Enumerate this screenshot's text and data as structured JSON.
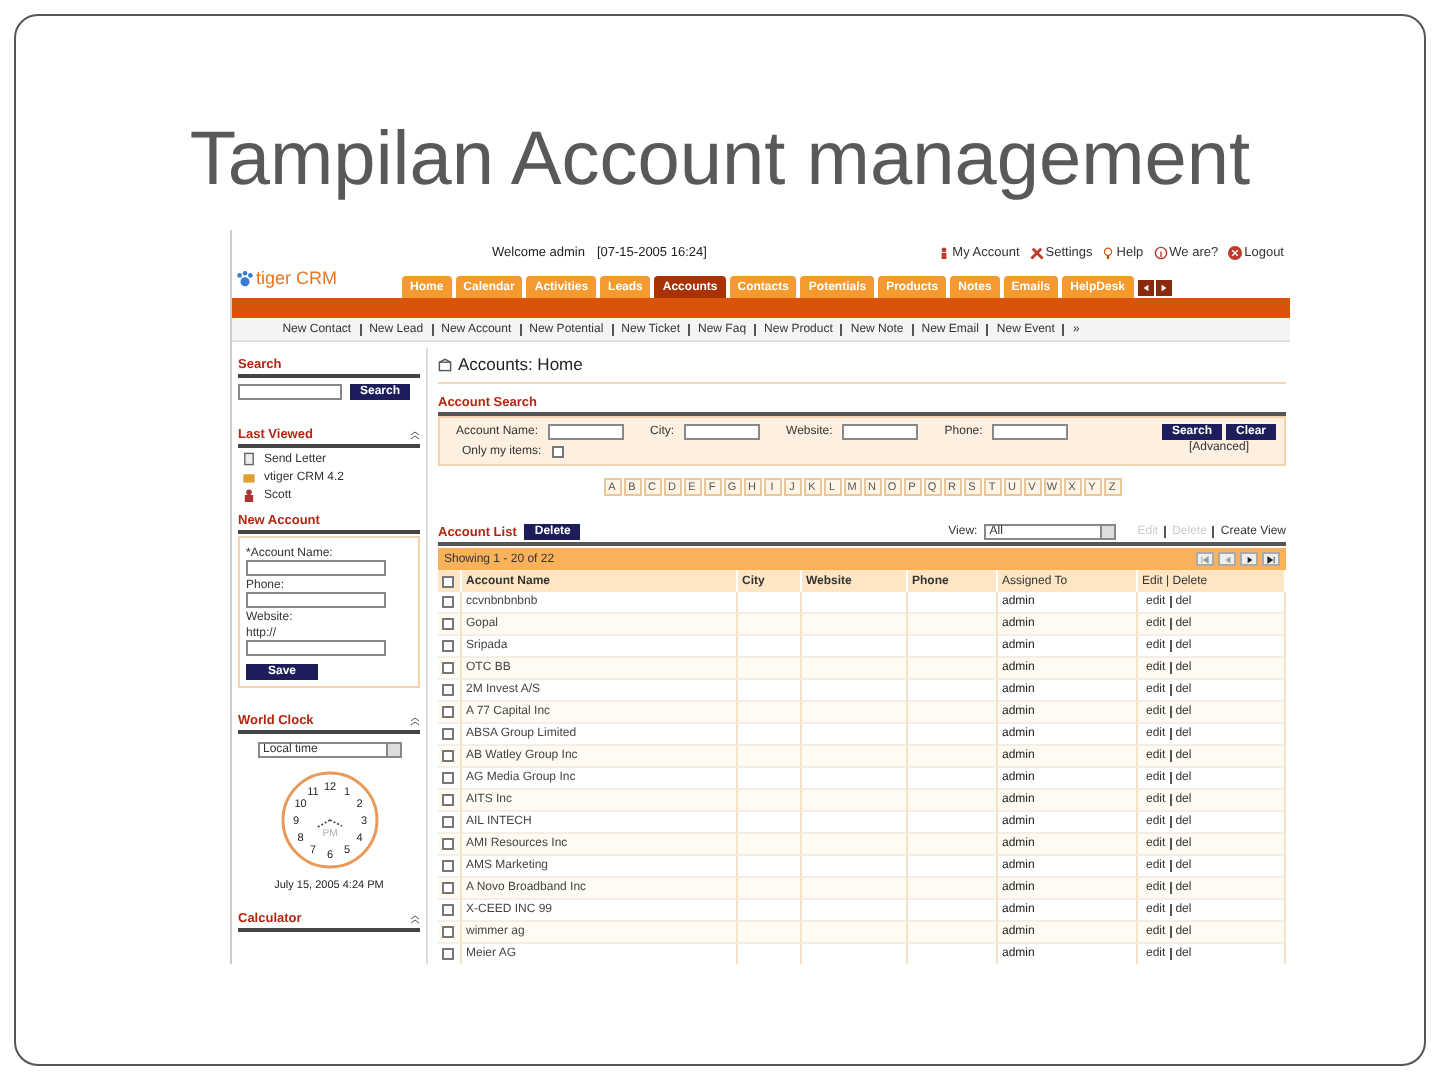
{
  "slide": {
    "title": "Tampilan Account management"
  },
  "header": {
    "logo": "tiger CRM",
    "welcome": "Welcome admin",
    "datetime": "[07-15-2005 16:24]",
    "links": [
      {
        "kind": "account",
        "label": "My Account"
      },
      {
        "kind": "settings",
        "label": "Settings"
      },
      {
        "kind": "help",
        "label": "Help"
      },
      {
        "kind": "about",
        "label": "We are?"
      },
      {
        "kind": "logout",
        "label": "Logout"
      }
    ]
  },
  "tabs": [
    {
      "label": "Home",
      "selected": false
    },
    {
      "label": "Calendar",
      "selected": false
    },
    {
      "label": "Activities",
      "selected": false
    },
    {
      "label": "Leads",
      "selected": false
    },
    {
      "label": "Accounts",
      "selected": true
    },
    {
      "label": "Contacts",
      "selected": false
    },
    {
      "label": "Potentials",
      "selected": false
    },
    {
      "label": "Products",
      "selected": false
    },
    {
      "label": "Notes",
      "selected": false
    },
    {
      "label": "Emails",
      "selected": false
    },
    {
      "label": "HelpDesk",
      "selected": false
    }
  ],
  "quick_links": [
    "New Contact",
    "New Lead",
    "New Account",
    "New Potential",
    "New Ticket",
    "New Faq",
    "New Product",
    "New Note",
    "New Email",
    "New Event",
    "»"
  ],
  "sidebar": {
    "search": {
      "title": "Search",
      "button": "Search"
    },
    "last_viewed": {
      "title": "Last Viewed",
      "items": [
        {
          "kind": "letter",
          "label": "Send Letter"
        },
        {
          "kind": "box",
          "label": "vtiger CRM 4.2"
        },
        {
          "kind": "person",
          "label": "Scott"
        }
      ]
    },
    "new_account": {
      "title": "New Account",
      "fields": [
        {
          "label": "*Account Name:"
        },
        {
          "label": "Phone:"
        },
        {
          "label": "Website:",
          "value": "http://"
        }
      ],
      "button": "Save"
    },
    "world_clock": {
      "title": "World Clock",
      "select": "Local time",
      "numbers": [
        "12",
        "11",
        "1",
        "10",
        "2",
        "9",
        "3",
        "8",
        "4",
        "7",
        "5",
        "6"
      ],
      "meridiem": "PM",
      "date": "July 15, 2005 4:24 PM"
    },
    "calculator": {
      "title": "Calculator"
    }
  },
  "main": {
    "title": "Accounts: Home",
    "search": {
      "title": "Account Search",
      "fields": [
        "Account Name:",
        "City:",
        "Website:",
        "Phone:"
      ],
      "only_mine": {
        "label": "Only my items:",
        "checked": false
      },
      "buttons": [
        "Search",
        "Clear"
      ],
      "advanced": "[Advanced]"
    },
    "letters": [
      "A",
      "B",
      "C",
      "D",
      "E",
      "F",
      "G",
      "H",
      "I",
      "J",
      "K",
      "L",
      "M",
      "N",
      "O",
      "P",
      "Q",
      "R",
      "S",
      "T",
      "U",
      "V",
      "W",
      "X",
      "Y",
      "Z"
    ],
    "list": {
      "title": "Account List",
      "delete_button": "Delete",
      "view_label": "View:",
      "view_value": "All",
      "actions": [
        {
          "label": "Edit",
          "disabled": true
        },
        {
          "label": "Delete",
          "disabled": true
        },
        {
          "label": "Create View",
          "disabled": false
        }
      ],
      "showing": "Showing 1 - 20 of 22",
      "select_all": false,
      "columns": [
        "Account Name",
        "City",
        "Website",
        "Phone",
        "Assigned To",
        "Edit | Delete"
      ],
      "rows": [
        {
          "name": "ccvnbnbnbnb",
          "assigned": "admin",
          "edit": "edit",
          "del": "del",
          "checked": false
        },
        {
          "name": "Gopal",
          "assigned": "admin",
          "edit": "edit",
          "del": "del",
          "checked": false
        },
        {
          "name": "Sripada",
          "assigned": "admin",
          "edit": "edit",
          "del": "del",
          "checked": false
        },
        {
          "name": "OTC BB",
          "assigned": "admin",
          "edit": "edit",
          "del": "del",
          "checked": false
        },
        {
          "name": "2M Invest A/S",
          "assigned": "admin",
          "edit": "edit",
          "del": "del",
          "checked": false
        },
        {
          "name": "A 77 Capital Inc",
          "assigned": "admin",
          "edit": "edit",
          "del": "del",
          "checked": false
        },
        {
          "name": "ABSA Group Limited",
          "assigned": "admin",
          "edit": "edit",
          "del": "del",
          "checked": false
        },
        {
          "name": "AB Watley Group Inc",
          "assigned": "admin",
          "edit": "edit",
          "del": "del",
          "checked": false
        },
        {
          "name": "AG Media Group Inc",
          "assigned": "admin",
          "edit": "edit",
          "del": "del",
          "checked": false
        },
        {
          "name": "AITS Inc",
          "assigned": "admin",
          "edit": "edit",
          "del": "del",
          "checked": false
        },
        {
          "name": "AIL INTECH",
          "assigned": "admin",
          "edit": "edit",
          "del": "del",
          "checked": false
        },
        {
          "name": "AMI Resources Inc",
          "assigned": "admin",
          "edit": "edit",
          "del": "del",
          "checked": false
        },
        {
          "name": "AMS Marketing",
          "assigned": "admin",
          "edit": "edit",
          "del": "del",
          "checked": false
        },
        {
          "name": "A Novo Broadband Inc",
          "assigned": "admin",
          "edit": "edit",
          "del": "del",
          "checked": false
        },
        {
          "name": "X-CEED INC 99",
          "assigned": "admin",
          "edit": "edit",
          "del": "del",
          "checked": false
        },
        {
          "name": "wimmer ag",
          "assigned": "admin",
          "edit": "edit",
          "del": "del",
          "checked": false
        },
        {
          "name": "Meier AG",
          "assigned": "admin",
          "edit": "edit",
          "del": "del",
          "checked": false
        }
      ]
    }
  }
}
